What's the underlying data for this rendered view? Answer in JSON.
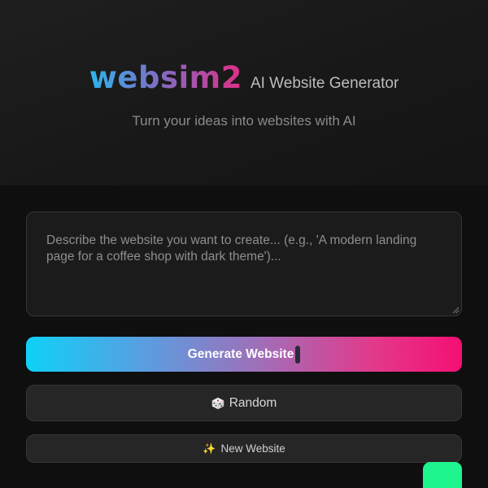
{
  "header": {
    "logo": "websim2",
    "tagline": "AI Website Generator",
    "subtitle": "Turn your ideas into websites with AI"
  },
  "prompt": {
    "placeholder": "Describe the website you want to create... (e.g., 'A modern landing page for a coffee shop with dark theme')...",
    "value": ""
  },
  "buttons": {
    "generate_label": "Generate Website",
    "random_label": "Random",
    "random_icon": "dice-icon",
    "new_label": "New Website",
    "new_icon": "sparkles-icon"
  },
  "colors": {
    "logo_gradient": [
      "#2cb4ec",
      "#7f6ec4",
      "#e02e86"
    ],
    "generate_gradient": [
      "#0fd1f7",
      "#a46cb6",
      "#f50f74"
    ],
    "fab": "#1ef58e",
    "background": "#0f0f0f"
  }
}
